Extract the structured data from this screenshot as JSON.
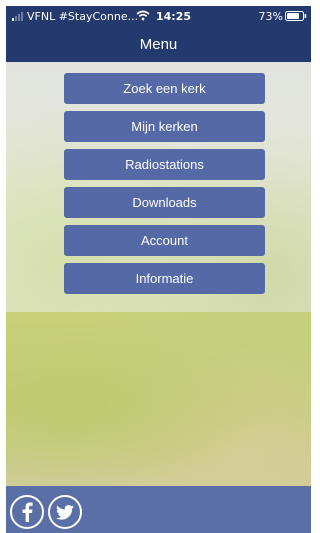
{
  "status_bar": {
    "carrier": "VFNL #StayConne...",
    "time": "14:25",
    "battery": "73%"
  },
  "header": {
    "title": "Menu"
  },
  "menu": {
    "items": [
      {
        "label": "Zoek een kerk"
      },
      {
        "label": "Mijn kerken"
      },
      {
        "label": "Radiostations"
      },
      {
        "label": "Downloads"
      },
      {
        "label": "Account"
      },
      {
        "label": "Informatie"
      }
    ]
  },
  "footer": {
    "icons": [
      "facebook-icon",
      "twitter-icon"
    ]
  },
  "colors": {
    "header_bg": "#243a6e",
    "button_bg": "#5469a6",
    "footer_bg": "#5b6fa7",
    "text": "#ffffff"
  }
}
